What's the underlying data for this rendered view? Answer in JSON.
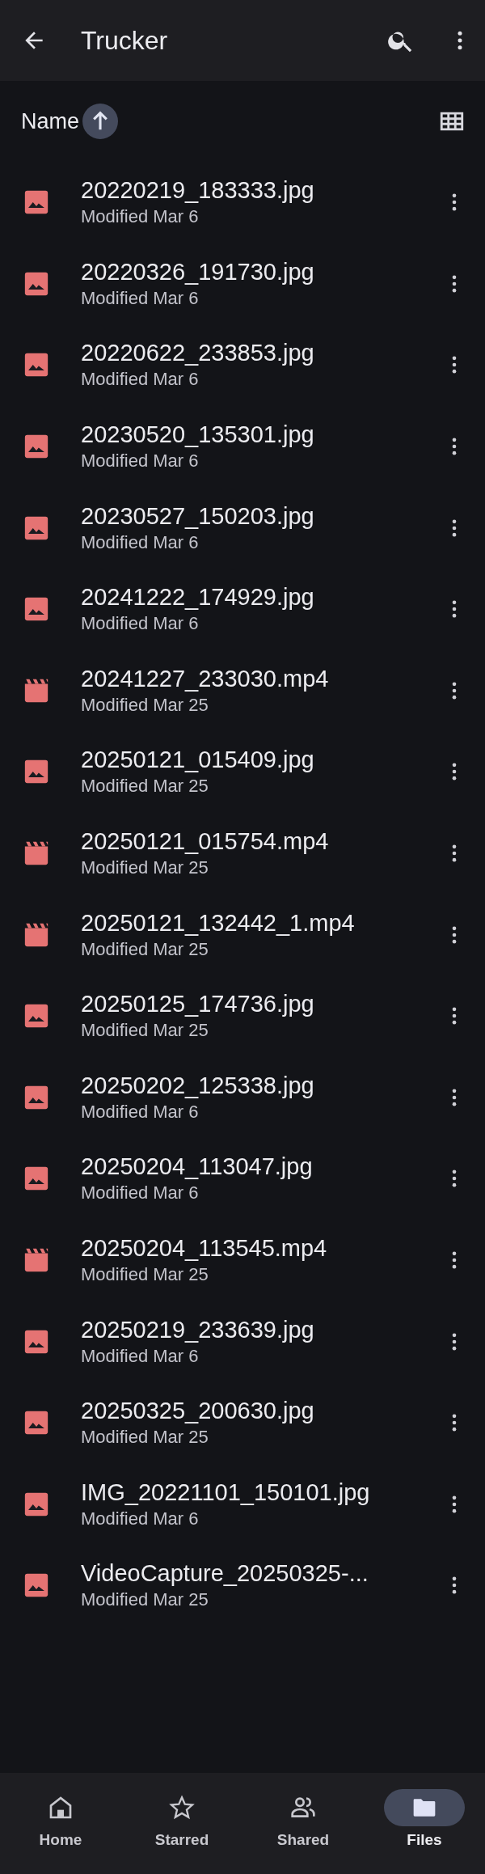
{
  "app_bar": {
    "title": "Trucker"
  },
  "sort": {
    "label": "Name"
  },
  "files": [
    {
      "name": "20220219_183333.jpg",
      "modified": "Modified Mar 6",
      "kind": "image"
    },
    {
      "name": "20220326_191730.jpg",
      "modified": "Modified Mar 6",
      "kind": "image"
    },
    {
      "name": "20220622_233853.jpg",
      "modified": "Modified Mar 6",
      "kind": "image"
    },
    {
      "name": "20230520_135301.jpg",
      "modified": "Modified Mar 6",
      "kind": "image"
    },
    {
      "name": "20230527_150203.jpg",
      "modified": "Modified Mar 6",
      "kind": "image"
    },
    {
      "name": "20241222_174929.jpg",
      "modified": "Modified Mar 6",
      "kind": "image"
    },
    {
      "name": "20241227_233030.mp4",
      "modified": "Modified Mar 25",
      "kind": "video"
    },
    {
      "name": "20250121_015409.jpg",
      "modified": "Modified Mar 25",
      "kind": "image"
    },
    {
      "name": "20250121_015754.mp4",
      "modified": "Modified Mar 25",
      "kind": "video"
    },
    {
      "name": "20250121_132442_1.mp4",
      "modified": "Modified Mar 25",
      "kind": "video"
    },
    {
      "name": "20250125_174736.jpg",
      "modified": "Modified Mar 25",
      "kind": "image"
    },
    {
      "name": "20250202_125338.jpg",
      "modified": "Modified Mar 6",
      "kind": "image"
    },
    {
      "name": "20250204_113047.jpg",
      "modified": "Modified Mar 6",
      "kind": "image"
    },
    {
      "name": "20250204_113545.mp4",
      "modified": "Modified Mar 25",
      "kind": "video"
    },
    {
      "name": "20250219_233639.jpg",
      "modified": "Modified Mar 6",
      "kind": "image"
    },
    {
      "name": "20250325_200630.jpg",
      "modified": "Modified Mar 25",
      "kind": "image"
    },
    {
      "name": "IMG_20221101_150101.jpg",
      "modified": "Modified Mar 6",
      "kind": "image"
    },
    {
      "name": "VideoCapture_20250325-...",
      "modified": "Modified Mar 25",
      "kind": "image"
    }
  ],
  "bottom_nav": [
    {
      "label": "Home",
      "kind": "home",
      "selected": false
    },
    {
      "label": "Starred",
      "kind": "star",
      "selected": false
    },
    {
      "label": "Shared",
      "kind": "shared",
      "selected": false
    },
    {
      "label": "Files",
      "kind": "folder",
      "selected": true
    }
  ]
}
